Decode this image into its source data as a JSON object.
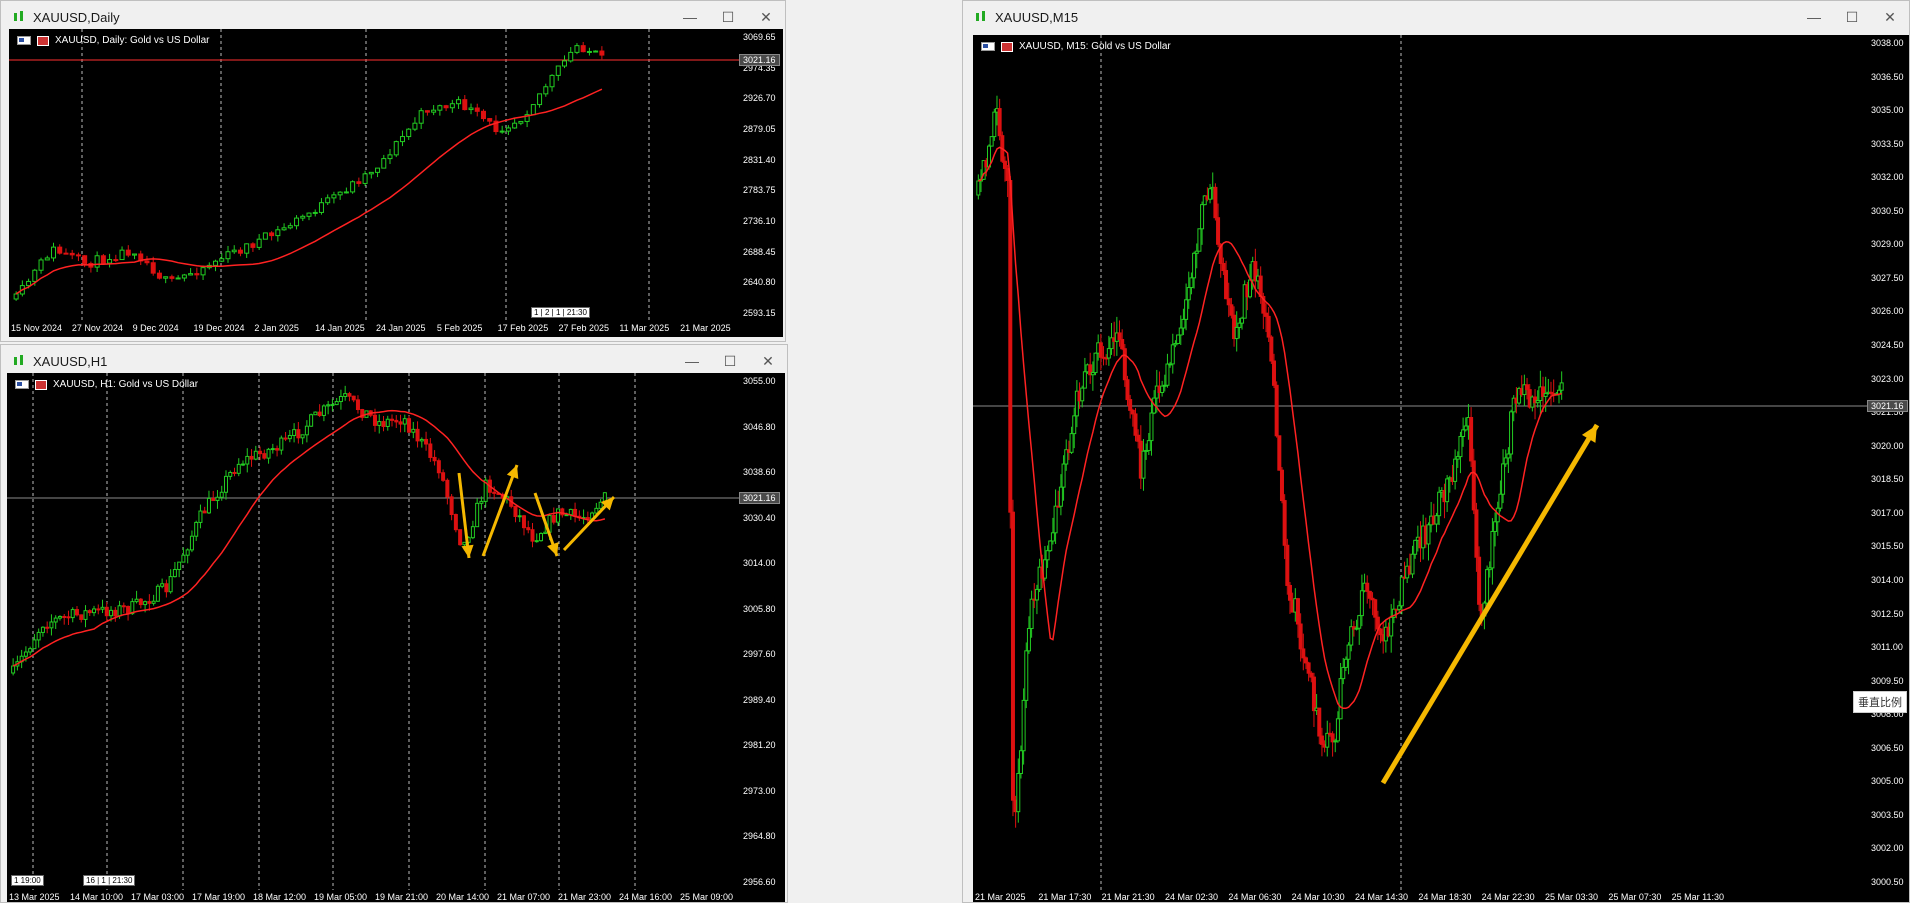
{
  "windows": {
    "daily": {
      "title": "XAUUSD,Daily",
      "label": "XAUUSD, Daily:  Gold vs US Dollar",
      "price_tag": "3021.16",
      "timestamp": "1 | 2 | 1 | 21:30",
      "y_ticks": [
        "3069.65",
        "3021.16",
        "2974.35",
        "2926.70",
        "2879.05",
        "2831.40",
        "2783.75",
        "2736.10",
        "2688.45",
        "2640.80",
        "2593.15"
      ],
      "x_ticks": [
        "15 Nov 2024",
        "27 Nov 2024",
        "9 Dec 2024",
        "19 Dec 2024",
        "2 Jan 2025",
        "14 Jan 2025",
        "24 Jan 2025",
        "5 Feb 2025",
        "17 Feb 2025",
        "27 Feb 2025",
        "11 Mar 2025",
        "21 Mar 2025"
      ]
    },
    "h1": {
      "title": "XAUUSD,H1",
      "label": "XAUUSD, H1:  Gold vs US Dollar",
      "price_tag": "3021.16",
      "timestamp_left": "1 19:00",
      "timestamp_mid": "16 | 1 | 21:30",
      "y_ticks": [
        "3055.00",
        "3046.80",
        "3038.60",
        "3030.40",
        "3021.16",
        "3014.00",
        "3005.80",
        "2997.60",
        "2989.40",
        "2981.20",
        "2973.00",
        "2964.80",
        "2956.60"
      ],
      "x_ticks": [
        "13 Mar 2025",
        "14 Mar 10:00",
        "17 Mar 03:00",
        "17 Mar 19:00",
        "18 Mar 12:00",
        "19 Mar 05:00",
        "19 Mar 21:00",
        "20 Mar 14:00",
        "21 Mar 07:00",
        "21 Mar 23:00",
        "24 Mar 16:00",
        "25 Mar 09:00"
      ]
    },
    "m15": {
      "title": "XAUUSD,M15",
      "label": "XAUUSD, M15:  Gold vs US Dollar",
      "price_tag": "3021.16",
      "side_tag": "垂直比例",
      "y_ticks": [
        "3038.00",
        "3036.50",
        "3035.00",
        "3033.50",
        "3032.00",
        "3030.50",
        "3029.00",
        "3027.50",
        "3026.00",
        "3024.50",
        "3023.00",
        "3021.50",
        "3021.16",
        "3020.00",
        "3018.50",
        "3017.00",
        "3015.50",
        "3014.00",
        "3012.50",
        "3011.00",
        "3009.50",
        "3008.00",
        "3006.50",
        "3005.00",
        "3003.50",
        "3002.00",
        "3000.50"
      ],
      "x_ticks": [
        "21 Mar 2025",
        "21 Mar 17:30",
        "21 Mar 21:30",
        "24 Mar 02:30",
        "24 Mar 06:30",
        "24 Mar 10:30",
        "24 Mar 14:30",
        "24 Mar 18:30",
        "24 Mar 22:30",
        "25 Mar 03:30",
        "25 Mar 07:30",
        "25 Mar 11:30"
      ]
    }
  },
  "buttons": {
    "minimize": "—",
    "maximize": "☐",
    "close": "✕"
  },
  "colors": {
    "bull": "#22cc22",
    "bear": "#dd1111",
    "ma": "#ff2222",
    "arrow": "#f5b800",
    "price_line": "#8a8a8a"
  }
}
